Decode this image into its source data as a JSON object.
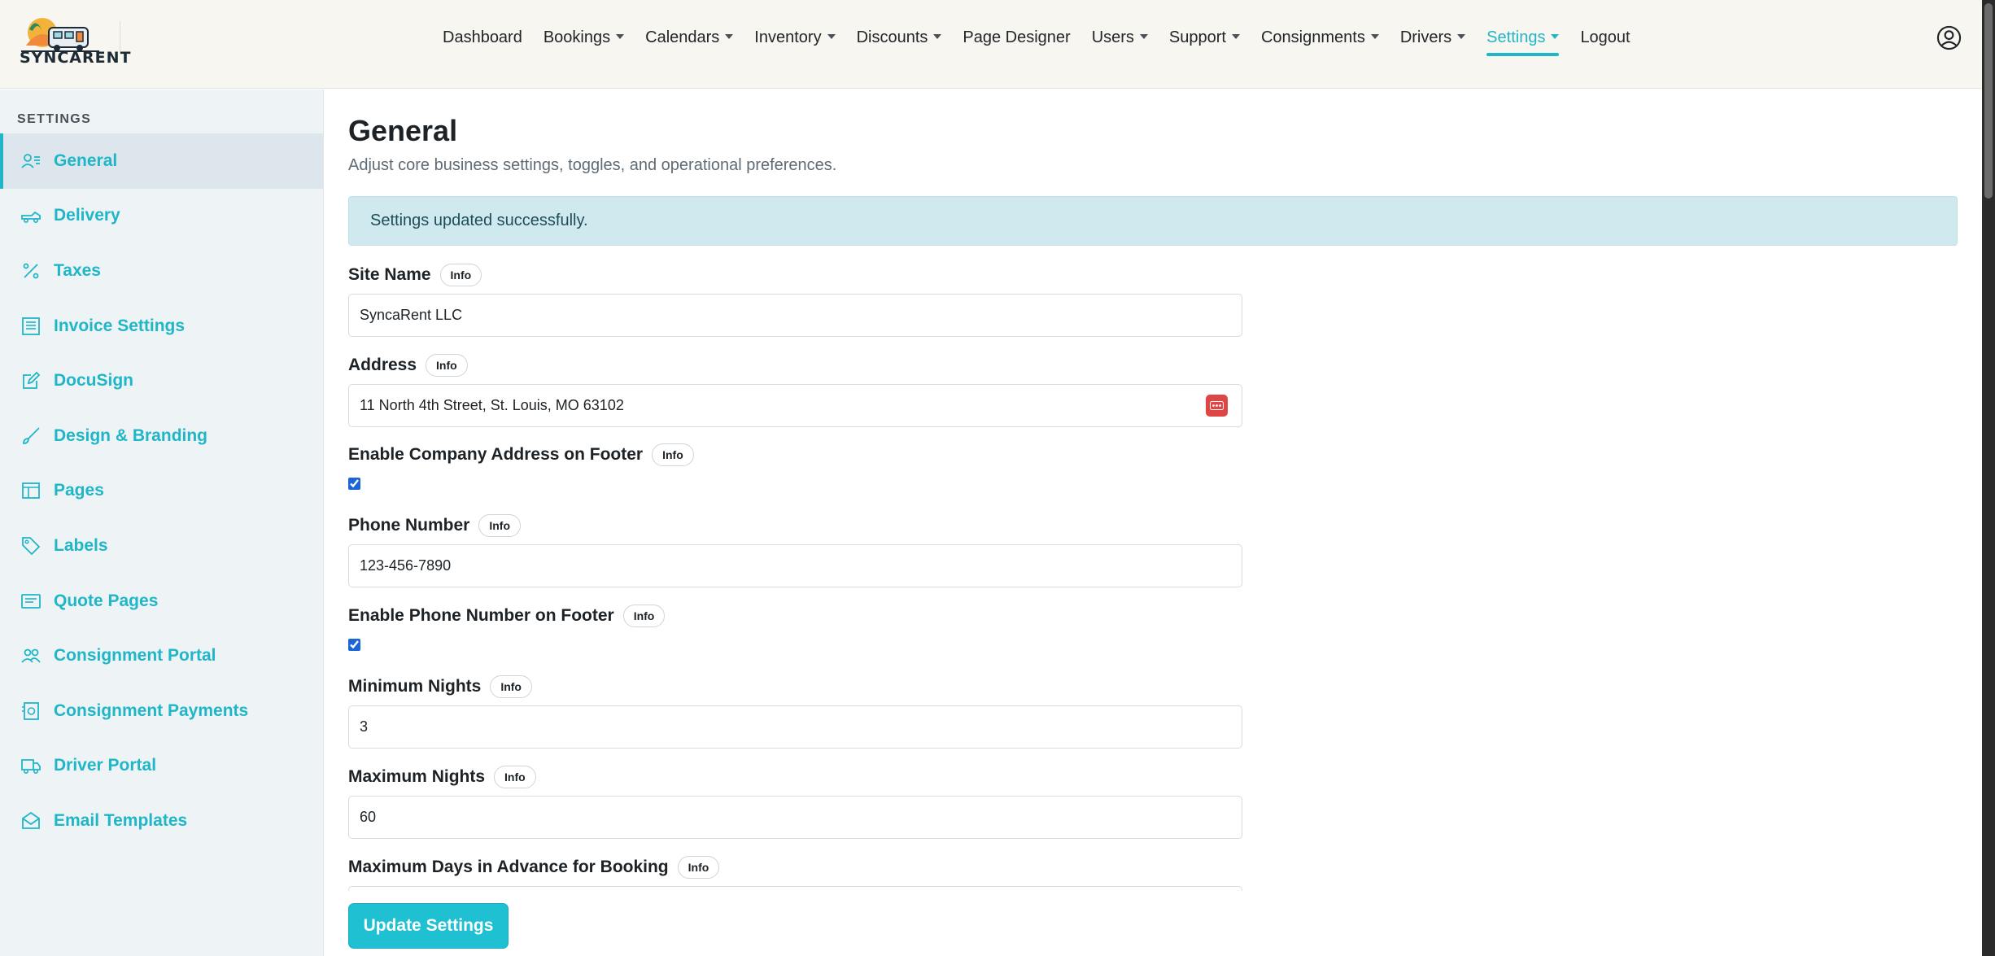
{
  "brand": {
    "name": "SYNCARENT"
  },
  "nav": {
    "items": [
      {
        "label": "Dashboard",
        "dropdown": false,
        "active": false
      },
      {
        "label": "Bookings",
        "dropdown": true,
        "active": false
      },
      {
        "label": "Calendars",
        "dropdown": true,
        "active": false
      },
      {
        "label": "Inventory",
        "dropdown": true,
        "active": false
      },
      {
        "label": "Discounts",
        "dropdown": true,
        "active": false
      },
      {
        "label": "Page Designer",
        "dropdown": false,
        "active": false
      },
      {
        "label": "Users",
        "dropdown": true,
        "active": false
      },
      {
        "label": "Support",
        "dropdown": true,
        "active": false
      },
      {
        "label": "Consignments",
        "dropdown": true,
        "active": false
      },
      {
        "label": "Drivers",
        "dropdown": true,
        "active": false
      },
      {
        "label": "Settings",
        "dropdown": true,
        "active": true
      },
      {
        "label": "Logout",
        "dropdown": false,
        "active": false
      }
    ],
    "user_icon": "user-circle-icon"
  },
  "sidebar": {
    "heading": "SETTINGS",
    "items": [
      {
        "label": "General",
        "icon": "user-list-icon",
        "active": true
      },
      {
        "label": "Delivery",
        "icon": "truck-icon",
        "active": false
      },
      {
        "label": "Taxes",
        "icon": "percent-icon",
        "active": false
      },
      {
        "label": "Invoice Settings",
        "icon": "invoice-icon",
        "active": false
      },
      {
        "label": "DocuSign",
        "icon": "pen-square-icon",
        "active": false
      },
      {
        "label": "Design & Branding",
        "icon": "brush-icon",
        "active": false
      },
      {
        "label": "Pages",
        "icon": "layout-icon",
        "active": false
      },
      {
        "label": "Labels",
        "icon": "tag-icon",
        "active": false
      },
      {
        "label": "Quote Pages",
        "icon": "quote-icon",
        "active": false
      },
      {
        "label": "Consignment Portal",
        "icon": "users-icon",
        "active": false
      },
      {
        "label": "Consignment Payments",
        "icon": "payment-icon",
        "active": false
      },
      {
        "label": "Driver Portal",
        "icon": "van-icon",
        "active": false
      },
      {
        "label": "Email Templates",
        "icon": "envelope-icon",
        "active": false
      }
    ]
  },
  "main": {
    "title": "General",
    "subtitle": "Adjust core business settings, toggles, and operational preferences.",
    "alert": "Settings updated successfully.",
    "info_label": "Info",
    "fields": {
      "site_name": {
        "label": "Site Name",
        "value": "SyncaRent LLC"
      },
      "address": {
        "label": "Address",
        "value": "11 North 4th Street, St. Louis, MO 63102"
      },
      "enable_address_footer": {
        "label": "Enable Company Address on Footer",
        "checked": true
      },
      "phone_number": {
        "label": "Phone Number",
        "value": "123-456-7890"
      },
      "enable_phone_footer": {
        "label": "Enable Phone Number on Footer",
        "checked": true
      },
      "minimum_nights": {
        "label": "Minimum Nights",
        "value": "3"
      },
      "maximum_nights": {
        "label": "Maximum Nights",
        "value": "60"
      },
      "max_days_advance": {
        "label": "Maximum Days in Advance for Booking"
      }
    },
    "submit_label": "Update Settings"
  },
  "colors": {
    "accent": "#1fb6c8",
    "alert_bg": "#cfe9ef",
    "button": "#1fc0d2"
  }
}
